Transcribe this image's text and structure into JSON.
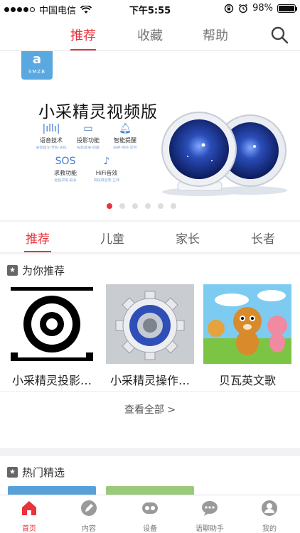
{
  "status": {
    "carrier": "中国电信",
    "time": "下午5:55",
    "battery": "98%",
    "battery_level": 0.98
  },
  "top_nav": {
    "tabs": [
      {
        "label": "推荐"
      },
      {
        "label": "收藏"
      },
      {
        "label": "帮助"
      }
    ],
    "active_index": 0
  },
  "banner": {
    "logo_text": "a",
    "logo_sub": "SMZB",
    "title": "小采精灵视频版",
    "features": [
      {
        "name": "语音技术",
        "desc": "语音指令·开机·关机"
      },
      {
        "name": "投影功能",
        "desc": "投影故事·动画"
      },
      {
        "name": "智能提醒",
        "desc": "闹钟·待办·定时"
      },
      {
        "name": "求救功能",
        "desc": "远程求助·联系"
      },
      {
        "name": "HiFi音效",
        "desc": "高保真音质·立体"
      }
    ],
    "pager_count": 6,
    "pager_active": 0
  },
  "categories": {
    "tabs": [
      {
        "label": "推荐"
      },
      {
        "label": "儿童"
      },
      {
        "label": "家长"
      },
      {
        "label": "长者"
      }
    ],
    "active_index": 0
  },
  "recommend": {
    "title": "为你推荐",
    "items": [
      {
        "title": "小采精灵投影…"
      },
      {
        "title": "小采精灵操作…"
      },
      {
        "title": "贝瓦英文歌"
      }
    ],
    "see_all": "查看全部 >"
  },
  "hot": {
    "title": "热门精选"
  },
  "tabbar": {
    "items": [
      {
        "label": "首页"
      },
      {
        "label": "内容"
      },
      {
        "label": "设备"
      },
      {
        "label": "语聊助手"
      },
      {
        "label": "我的"
      }
    ],
    "active_index": 0
  },
  "colors": {
    "accent": "#e8333c",
    "logo_blue": "#5aa8e0"
  }
}
